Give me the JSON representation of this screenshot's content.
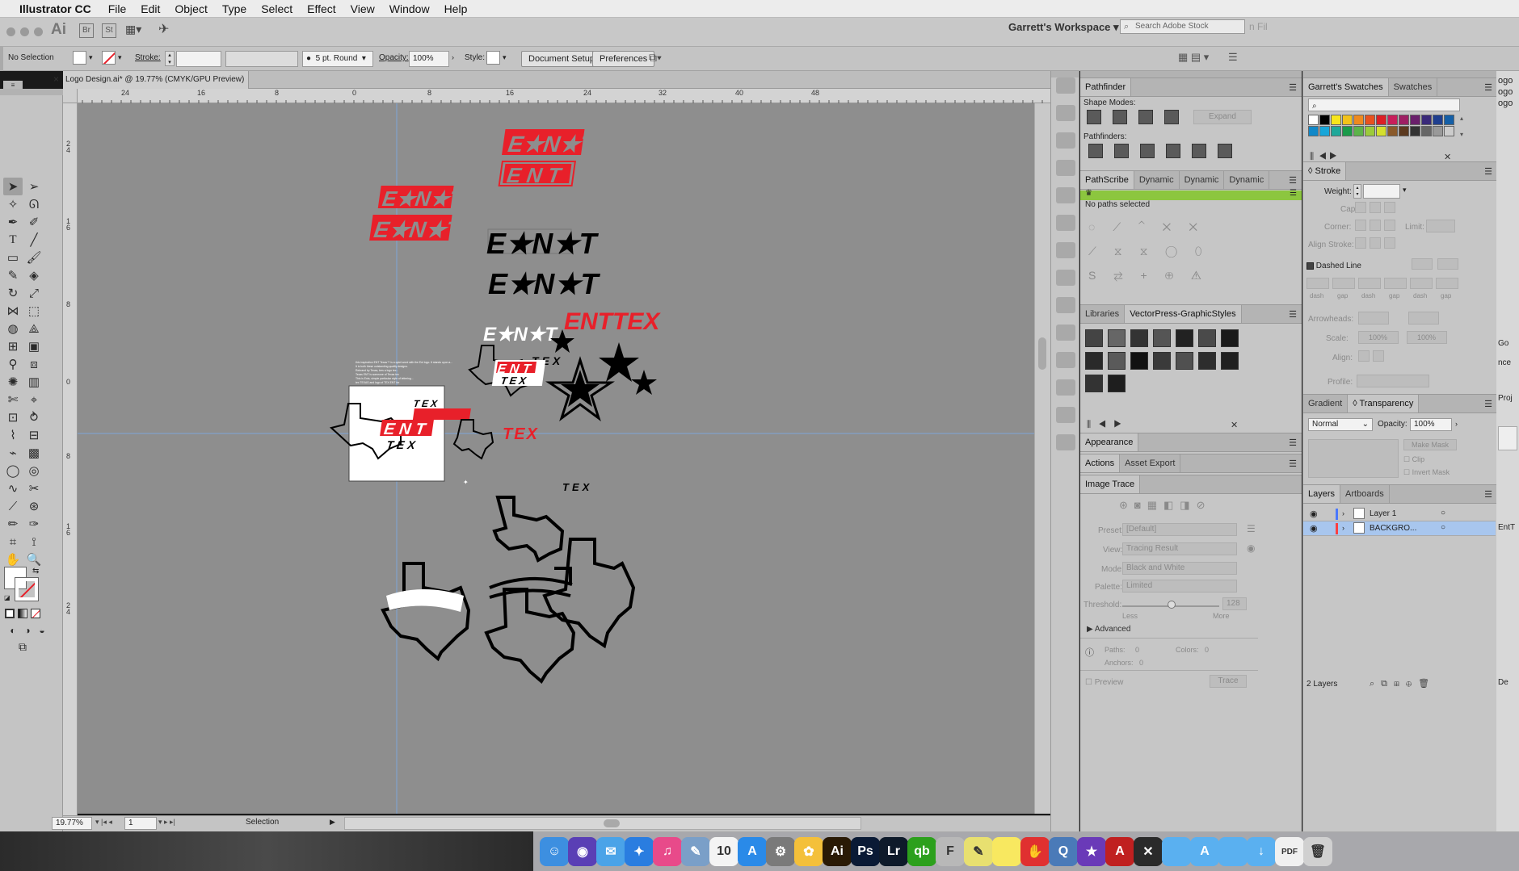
{
  "menubar": {
    "apple": "",
    "app_name": "Illustrator CC",
    "items": [
      "File",
      "Edit",
      "Object",
      "Type",
      "Select",
      "Effect",
      "View",
      "Window",
      "Help"
    ]
  },
  "app_header": {
    "ai_logo": "Ai",
    "br": "Br",
    "st": "St",
    "workspace": "Garrett's Workspace",
    "search_placeholder": "Search Adobe Stock",
    "partial_right": "n Fil"
  },
  "control_bar": {
    "selection": "No Selection",
    "stroke_label": "Stroke:",
    "brush": "5 pt. Round",
    "opacity_label": "Opacity:",
    "opacity_value": "100%",
    "style_label": "Style:",
    "document_setup": "Document Setup",
    "preferences": "Preferences"
  },
  "document": {
    "tab_title": "Logo Design.ai* @ 19.77% (CMYK/GPU Preview)",
    "close": "×"
  },
  "ruler": {
    "h_ticks": [
      "24",
      "16",
      "8",
      "0",
      "8",
      "16",
      "24",
      "32",
      "40",
      "48"
    ],
    "v_ticks": [
      "2\n4",
      "1\n6",
      "8",
      "0",
      "8",
      "1\n6",
      "2\n4"
    ]
  },
  "status_bar": {
    "zoom": "19.77%",
    "artboard": "1",
    "tool": "Selection"
  },
  "artwork": {
    "ent": "E N T",
    "ent_stars": "E★N★T",
    "ent_tex": "ENTTEX",
    "tex": "TEX",
    "small_text_lines": [
      "this inspiration ENT Texas™ is a quiet word with the Ent logo. It stands upon a...",
      "It is both these outstanding quality designs.",
      "Rebrand by Texas, tres a logo tex...",
      "Texas ENT is someone of Texas tex",
      "This is Ents, simple particular style of lettering...",
      "tex TEXAS and logo of TEX ENT for",
      "LOGO ENTEX Texas, Dermatology for a logo and medical in the shape."
    ]
  },
  "pathfinder": {
    "tab": "Pathfinder",
    "shape_modes": "Shape Modes:",
    "expand": "Expand",
    "pathfinders": "Pathfinders:"
  },
  "pathscribe": {
    "tabs": [
      "PathScribe",
      "Dynamic",
      "Dynamic",
      "Dynamic"
    ],
    "status": "No paths selected"
  },
  "libraries": {
    "tabs": [
      "Libraries",
      "VectorPress-GraphicStyles"
    ]
  },
  "appearance": {
    "tab": "Appearance"
  },
  "actions": {
    "tabs": [
      "Actions",
      "Asset Export"
    ]
  },
  "image_trace": {
    "tab": "Image Trace",
    "preset_label": "Preset:",
    "preset_value": "[Default]",
    "view_label": "View:",
    "view_value": "Tracing Result",
    "mode_label": "Mode:",
    "mode_value": "Black and White",
    "palette_label": "Palette:",
    "palette_value": "Limited",
    "threshold_label": "Threshold:",
    "threshold_value": "128",
    "less": "Less",
    "more": "More",
    "advanced": "Advanced",
    "paths_label": "Paths:",
    "paths_value": "0",
    "colors_label": "Colors:",
    "colors_value": "0",
    "anchors_label": "Anchors:",
    "anchors_value": "0",
    "preview": "Preview",
    "trace": "Trace"
  },
  "swatches": {
    "tabs": [
      "Garrett's Swatches",
      "Swatches"
    ],
    "colors": [
      "#ffffff",
      "#000000",
      "#f7e51b",
      "#f2c21a",
      "#ee8a1f",
      "#e8521f",
      "#dc1f26",
      "#c81e5b",
      "#9e1f63",
      "#6a1f6b",
      "#3a2a7a",
      "#1f3f8f",
      "#145fa7",
      "#1188c8",
      "#18a6d9",
      "#1fa89a",
      "#1a9a4a",
      "#5db34a",
      "#9ccb3b",
      "#d4df2e",
      "#8a5a2b",
      "#5c3a1f",
      "#333333",
      "#666666",
      "#999999",
      "#cccccc"
    ]
  },
  "stroke": {
    "tab": "Stroke",
    "weight_label": "Weight:",
    "cap_label": "Cap:",
    "corner_label": "Corner:",
    "limit_label": "Limit:",
    "align_label": "Align Stroke:",
    "dashed_line": "Dashed Line",
    "dash_labels": [
      "dash",
      "gap",
      "dash",
      "gap",
      "dash",
      "gap"
    ],
    "arrowheads": "Arrowheads:",
    "scale": "Scale:",
    "scale_a": "100%",
    "scale_b": "100%",
    "align": "Align:",
    "profile": "Profile:"
  },
  "transparency": {
    "tabs": [
      "Gradient",
      "Transparency"
    ],
    "mode": "Normal",
    "opacity_label": "Opacity:",
    "opacity_value": "100%",
    "make_mask": "Make Mask",
    "clip": "Clip",
    "invert_mask": "Invert Mask"
  },
  "layers": {
    "tabs": [
      "Layers",
      "Artboards"
    ],
    "rows": [
      {
        "name": "Layer 1",
        "color": "#4a78ff"
      },
      {
        "name": "BACKGRO...",
        "color": "#ff4040"
      }
    ],
    "count": "2 Layers"
  },
  "far_right": {
    "labels": [
      "ogo",
      "ogo",
      "ogo",
      "Go",
      "nce",
      "Proj",
      "EntT",
      "De"
    ]
  },
  "dock": {
    "items": [
      {
        "name": "finder",
        "color": "#3d8fe0",
        "label": "☺"
      },
      {
        "name": "siri",
        "color": "#5a3fb5",
        "label": "◉"
      },
      {
        "name": "messages-like",
        "color": "#4aa3e8",
        "label": "✉"
      },
      {
        "name": "safari",
        "color": "#2a7de0",
        "label": "✦"
      },
      {
        "name": "itunes",
        "color": "#e84a8a",
        "label": "♫"
      },
      {
        "name": "preview",
        "color": "#7a9fc8",
        "label": "✎"
      },
      {
        "name": "calendar",
        "color": "#f4f4f4",
        "label": "10"
      },
      {
        "name": "app-store",
        "color": "#2a8ae8",
        "label": "A"
      },
      {
        "name": "system-prefs",
        "color": "#7a7a7a",
        "label": "⚙"
      },
      {
        "name": "photos",
        "color": "#f4c03a",
        "label": "✿"
      },
      {
        "name": "illustrator",
        "color": "#2a1a05",
        "label": "Ai"
      },
      {
        "name": "photoshop",
        "color": "#0a1a35",
        "label": "Ps"
      },
      {
        "name": "lightroom",
        "color": "#0e1a2a",
        "label": "Lr"
      },
      {
        "name": "quickbooks",
        "color": "#2ca01c",
        "label": "qb"
      },
      {
        "name": "texteditor",
        "color": "#b8b8b8",
        "label": "F"
      },
      {
        "name": "notes-folder",
        "color": "#e8e070",
        "label": "✎"
      },
      {
        "name": "stickies",
        "color": "#f8e860",
        "label": ""
      },
      {
        "name": "acrobat-like",
        "color": "#e03030",
        "label": "✋"
      },
      {
        "name": "quicktime",
        "color": "#4a7ab8",
        "label": "Q"
      },
      {
        "name": "imovie",
        "color": "#6a3ab8",
        "label": "★"
      },
      {
        "name": "acrobat",
        "color": "#c02020",
        "label": "A"
      },
      {
        "name": "terminal",
        "color": "#2a2a2a",
        "label": "✕"
      },
      {
        "name": "folder-1",
        "color": "#5ab0f0",
        "label": ""
      },
      {
        "name": "folder-apps",
        "color": "#5ab0f0",
        "label": "A"
      },
      {
        "name": "folder-docs",
        "color": "#5ab0f0",
        "label": ""
      },
      {
        "name": "folder-downloads",
        "color": "#5ab0f0",
        "label": "↓"
      },
      {
        "name": "pdf-doc",
        "color": "#f0f0f0",
        "label": "PDF"
      },
      {
        "name": "trash",
        "color": "#d0d0d0",
        "label": "🗑"
      }
    ]
  },
  "colors": {
    "brand_red": "#e8202a",
    "green_bar": "#8cc63f",
    "canvas": "#8e8e8e",
    "panel": "#c6c6c6"
  }
}
